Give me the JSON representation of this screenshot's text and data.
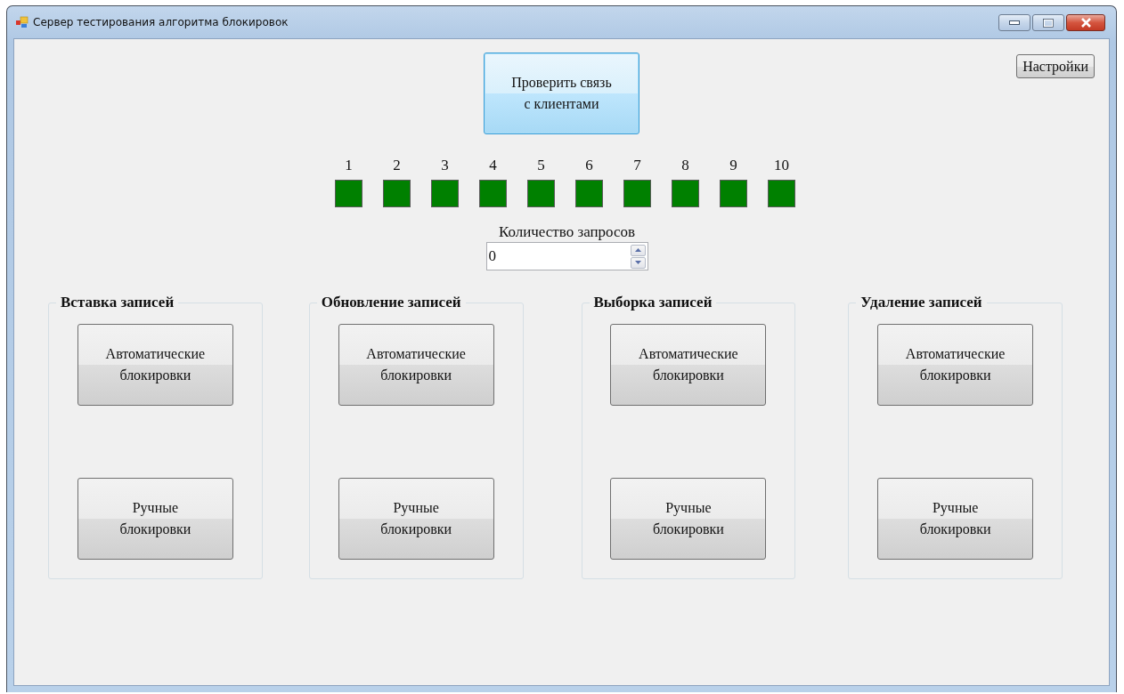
{
  "window": {
    "title": "Сервер тестирования алгоритма блокировок"
  },
  "check_button": {
    "label": "Проверить связь\nс клиентами",
    "focused": true
  },
  "settings_button": {
    "label": "Настройки"
  },
  "clients": [
    {
      "label": "1",
      "color": "#008000"
    },
    {
      "label": "2",
      "color": "#008000"
    },
    {
      "label": "3",
      "color": "#008000"
    },
    {
      "label": "4",
      "color": "#008000"
    },
    {
      "label": "5",
      "color": "#008000"
    },
    {
      "label": "6",
      "color": "#008000"
    },
    {
      "label": "7",
      "color": "#008000"
    },
    {
      "label": "8",
      "color": "#008000"
    },
    {
      "label": "9",
      "color": "#008000"
    },
    {
      "label": "10",
      "color": "#008000"
    }
  ],
  "request_count": {
    "label": "Количество запросов",
    "value": "0"
  },
  "groups": [
    {
      "title": "Вставка записей",
      "buttons": [
        "Автоматические\nблокировки",
        "Ручные\nблокировки"
      ]
    },
    {
      "title": "Обновление записей",
      "buttons": [
        "Автоматические\nблокировки",
        "Ручные\nблокировки"
      ]
    },
    {
      "title": "Выборка записей",
      "buttons": [
        "Автоматические\nблокировки",
        "Ручные\nблокировки"
      ]
    },
    {
      "title": "Удаление записей",
      "buttons": [
        "Автоматические\nблокировки",
        "Ручные\nблокировки"
      ]
    }
  ]
}
